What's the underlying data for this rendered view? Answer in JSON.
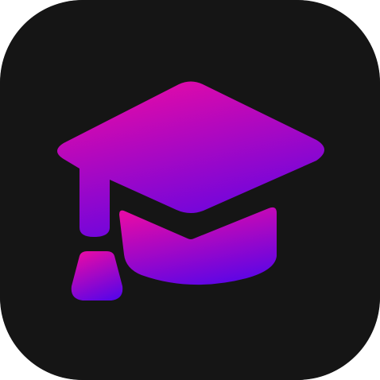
{
  "app_icon": {
    "icon": "graduation-cap-icon",
    "colors": {
      "background": "#151515",
      "gradient_start": "#e30aa8",
      "gradient_end": "#5b05e6"
    }
  }
}
